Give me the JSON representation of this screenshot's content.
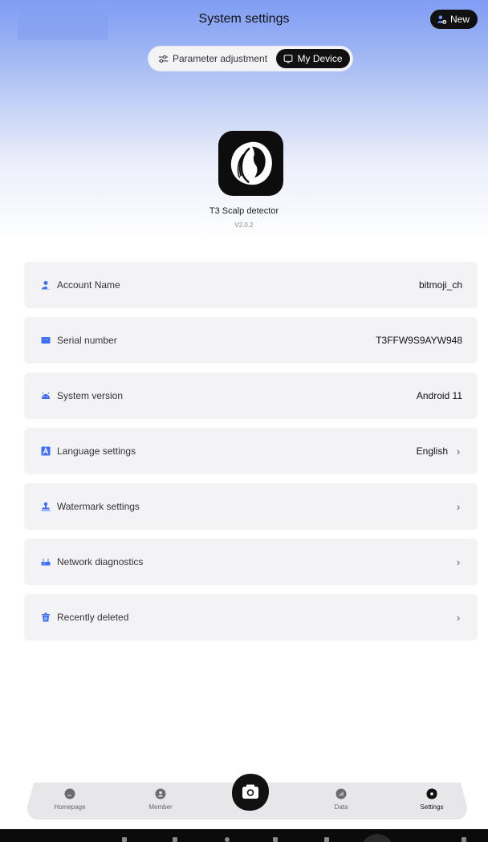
{
  "header": {
    "title": "System settings",
    "new_label": "New"
  },
  "tabs": {
    "parameter_label": "Parameter adjustment",
    "device_label": "My Device",
    "active": "My Device"
  },
  "app": {
    "name": "T3  Scalp detector",
    "version": "V2.0.2",
    "logo_icon": "woman-profile-logo"
  },
  "rows": [
    {
      "label": "Account Name",
      "value": "bitmoji_ch",
      "icon": "user-icon",
      "icon_color": "#3b6ef5",
      "chevron": false
    },
    {
      "label": "Serial number",
      "value": "T3FFW9S9AYW948",
      "icon": "serial-icon",
      "icon_color": "#3b6ef5",
      "chevron": false
    },
    {
      "label": "System version",
      "value": "Android 11",
      "icon": "android-icon",
      "icon_color": "#3b6ef5",
      "chevron": false
    },
    {
      "label": "Language settings",
      "value": "English",
      "icon": "language-icon",
      "icon_color": "#3b6ef5",
      "chevron": true
    },
    {
      "label": "Watermark settings",
      "value": "",
      "icon": "stamp-icon",
      "icon_color": "#3b6ef5",
      "chevron": true
    },
    {
      "label": "Network diagnostics",
      "value": "",
      "icon": "router-icon",
      "icon_color": "#3b6ef5",
      "chevron": true
    },
    {
      "label": "Recently deleted",
      "value": "",
      "icon": "trash-icon",
      "icon_color": "#3b6ef5",
      "chevron": true
    }
  ],
  "nav": {
    "items": [
      {
        "label": "Homepage",
        "icon": "home-icon"
      },
      {
        "label": "Member",
        "icon": "member-icon"
      },
      {
        "label": "Data",
        "icon": "data-icon"
      },
      {
        "label": "Settings",
        "icon": "settings-icon"
      }
    ],
    "active": "Settings",
    "camera_icon": "camera-icon"
  },
  "colors": {
    "accent": "#3b6ef5",
    "dark": "#111111",
    "row_bg": "#f3f3f6"
  }
}
